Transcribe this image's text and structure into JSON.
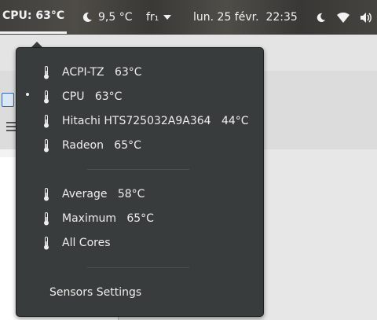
{
  "topbar": {
    "cpu_label": "CPU: 63°C",
    "weather": "9,5 °C",
    "language": "fr₁",
    "datetime": "lun. 25 févr.  22:35"
  },
  "menu": {
    "sensors": [
      {
        "label": "ACPI-TZ   63°C",
        "selected": false
      },
      {
        "label": "CPU   63°C",
        "selected": true
      },
      {
        "label": "Hitachi HTS725032A9A364   44°C",
        "selected": false
      },
      {
        "label": "Radeon   65°C",
        "selected": false
      }
    ],
    "summary": [
      {
        "label": "Average   58°C"
      },
      {
        "label": "Maximum   65°C"
      },
      {
        "label": "All Cores"
      }
    ],
    "settings_label": "Sensors Settings"
  },
  "icons": {
    "sensor": "thermometer-icon",
    "weather": "moon-icon",
    "night_light": "moon-icon",
    "network": "wifi-icon",
    "sound": "volume-icon"
  },
  "colors": {
    "menu_bg": "#383c3c",
    "menu_text": "#eeeeec"
  }
}
